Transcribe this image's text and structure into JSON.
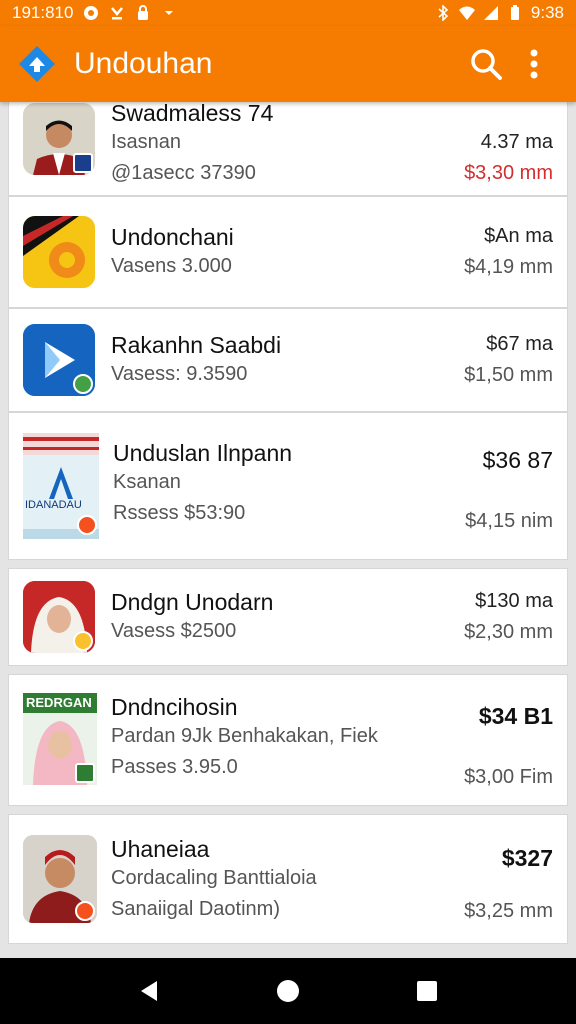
{
  "status": {
    "left_text": "191:810",
    "time": "9:38"
  },
  "appbar": {
    "title": "Undouhan",
    "colors": {
      "primary": "#f57c00"
    }
  },
  "items": [
    {
      "title": "Swadmaless 74",
      "line2": "Isasnan",
      "line3": "@1asecc 37390",
      "price1": "4.37 ma",
      "price2": "$3,30 mm",
      "price2_color": "red"
    },
    {
      "title": "Undonchani",
      "line2": "Vasens  3.000",
      "price1": "$An ma",
      "price2": "$4,19 mm"
    },
    {
      "title": "Rakanhn Saabdi",
      "line2": "Vasess: 9.3590",
      "price1": "$67 ma",
      "price2": "$1,50 mm"
    },
    {
      "title": "Unduslan Ilnpann",
      "line2": "Ksanan",
      "line3": "Rssess  $53:90",
      "price1": "$36 87",
      "price2": "$4,15 nim",
      "thumb_text_top": "IDANADAU",
      "thumb_letter": "A"
    },
    {
      "title": "Dndgn Unodarn",
      "line2": "Vasess  $2500",
      "price1": "$130 ma",
      "price2": "$2,30 mm"
    },
    {
      "title": "Dndncihosin",
      "line2": "Pardan 9Jk Benhakakan, Fiek",
      "line3": "Passes  3.95.0",
      "price1": "$34 B1",
      "price2": "$3,00 Fim",
      "thumb_text_top": "REDRGAN"
    },
    {
      "title": "Uhaneiaa",
      "line2": "Cordacaling Banttialoia",
      "line3": "Sanaiigal Daotinm)",
      "price1": "$327",
      "price2": "$3,25 mm"
    }
  ]
}
